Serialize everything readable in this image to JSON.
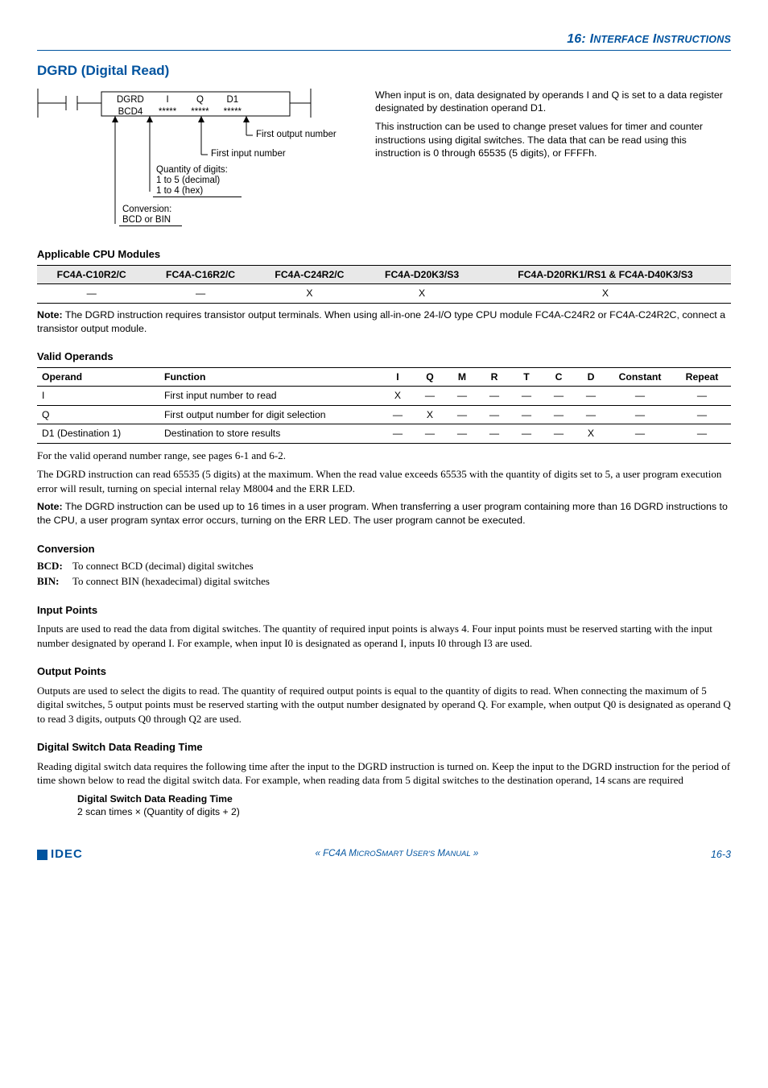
{
  "chapter": {
    "num": "16:",
    "rest_i": "I",
    "rest": "NTERFACE",
    "rest2_i": "I",
    "rest2": "NSTRUCTIONS"
  },
  "section_title": "DGRD (Digital Read)",
  "ladder": {
    "box": {
      "a": "DGRD",
      "b": "I",
      "c": "Q",
      "d": "D1",
      "a2": "BCD4",
      "s1": "*****",
      "s2": "*****",
      "s3": "*****"
    },
    "lbl_first_output": "First output number",
    "lbl_first_input": "First input number",
    "lbl_qty": "Quantity of digits:",
    "lbl_qty1": "1 to 5 (decimal)",
    "lbl_qty2": "1 to 4 (hex)",
    "lbl_conv": "Conversion:",
    "lbl_conv2": "BCD or BIN"
  },
  "side1": "When input is on, data designated by operands I and Q is set to a data register designated by destination operand D1.",
  "side2": "This instruction can be used to change preset values for timer and counter instructions using digital switches. The data that can be read using this instruction is 0 through 65535 (5 digits), or FFFFh.",
  "cpu_heading": "Applicable CPU Modules",
  "cpu_table": {
    "h": [
      "FC4A-C10R2/C",
      "FC4A-C16R2/C",
      "FC4A-C24R2/C",
      "FC4A-D20K3/S3",
      "FC4A-D20RK1/RS1 & FC4A-D40K3/S3"
    ],
    "r": [
      "—",
      "—",
      "X",
      "X",
      "X"
    ]
  },
  "note1a": "Note:",
  "note1": " The DGRD instruction requires transistor output terminals. When using all-in-one 24-I/O type CPU module FC4A-C24R2 or FC4A-C24R2C, connect a transistor output module.",
  "valid_heading": "Valid Operands",
  "oper": {
    "head": {
      "op": "Operand",
      "fn": "Function",
      "cols": [
        "I",
        "Q",
        "M",
        "R",
        "T",
        "C",
        "D"
      ],
      "const": "Constant",
      "rep": "Repeat"
    },
    "rows": [
      {
        "op": "I",
        "fn": "First input number to read",
        "v": [
          "X",
          "—",
          "—",
          "—",
          "—",
          "—",
          "—"
        ],
        "c": "—",
        "r": "—"
      },
      {
        "op": "Q",
        "fn": "First output number for digit selection",
        "v": [
          "—",
          "X",
          "—",
          "—",
          "—",
          "—",
          "—"
        ],
        "c": "—",
        "r": "—"
      },
      {
        "op": "D1 (Destination 1)",
        "fn": "Destination to store results",
        "v": [
          "—",
          "—",
          "—",
          "—",
          "—",
          "—",
          "X"
        ],
        "c": "—",
        "r": "—"
      }
    ]
  },
  "para_range": "For the valid operand number range, see pages 6-1 and 6-2.",
  "para_max": "The DGRD instruction can read 65535 (5 digits) at the maximum. When the read value exceeds 65535 with the quantity of digits set to 5, a user program execution error will result, turning on special internal relay M8004 and the ERR LED.",
  "note2a": "Note:",
  "note2": " The DGRD instruction can be used up to 16 times in a user program. When transferring a user program containing more than 16 DGRD instructions to the CPU, a user program syntax error occurs, turning on the ERR LED. The user program cannot be executed.",
  "conv_heading": "Conversion",
  "conv_bcd_k": "BCD:",
  "conv_bcd_v": "To connect BCD (decimal) digital switches",
  "conv_bin_k": "BIN:",
  "conv_bin_v": "To connect BIN (hexadecimal) digital switches",
  "ip_heading": "Input Points",
  "ip_para": "Inputs are used to read the data from digital switches. The quantity of required input points is always 4. Four input points must be reserved starting with the input number designated by operand I. For example, when input I0 is designated as operand I, inputs I0 through I3 are used.",
  "op_heading": "Output Points",
  "op_para": "Outputs are used to select the digits to read. The quantity of required output points is equal to the quantity of digits to read. When connecting the maximum of 5 digital switches, 5 output points must be reserved starting with the output number designated by operand Q. For example, when output Q0 is designated as operand Q to read 3 digits, outputs Q0 through Q2 are used.",
  "rt_heading": "Digital Switch Data Reading Time",
  "rt_para": "Reading digital switch data requires the following time after the input to the DGRD instruction is turned on. Keep the input to the DGRD instruction for the period of time shown below to read the digital switch data. For example, when reading data from 5 digital switches to the destination operand, 14 scans are required",
  "rt_title": "Digital Switch Data Reading Time",
  "rt_formula": "2 scan times × (Quantity of digits + 2)",
  "footer": {
    "logo": "IDEC",
    "center_a": "« FC4A M",
    "center_b": "ICRO",
    "center_c": "S",
    "center_d": "MART",
    "center_e": " U",
    "center_f": "SER'S",
    "center_g": " M",
    "center_h": "ANUAL",
    "center_i": " »",
    "page": "16-3"
  }
}
